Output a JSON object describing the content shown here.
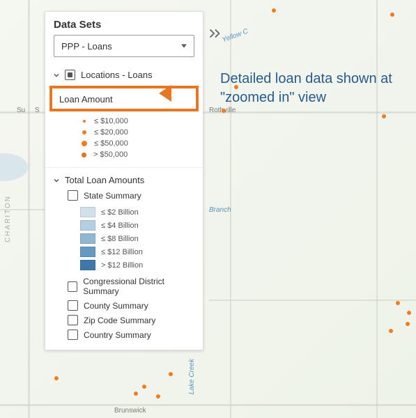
{
  "panel": {
    "title": "Data Sets",
    "dropdown_value": "PPP - Loans",
    "section1": {
      "title": "Locations - Loans",
      "checked": true,
      "highlight_label": "Loan Amount",
      "legend": [
        {
          "label": "≤ $10,000"
        },
        {
          "label": "≤ $20,000"
        },
        {
          "label": "≤ $50,000"
        },
        {
          "label": "> $50,000"
        }
      ]
    },
    "section2": {
      "title": "Total Loan Amounts",
      "state_summary": {
        "label": "State Summary",
        "swatches": [
          {
            "label": "≤ $2 Billion",
            "color": "#d0e1ec"
          },
          {
            "label": "≤ $4 Billion",
            "color": "#b3cfe1"
          },
          {
            "label": "≤ $8 Billion",
            "color": "#8fb7d2"
          },
          {
            "label": "≤ $12 Billion",
            "color": "#6699c2"
          },
          {
            "label": "> $12 Billion",
            "color": "#3d78a8"
          }
        ]
      },
      "items": [
        {
          "label": "Congressional District Summary"
        },
        {
          "label": "County Summary"
        },
        {
          "label": "Zip Code Summary"
        },
        {
          "label": "Country Summary"
        }
      ]
    }
  },
  "annotation_text": "Detailed loan data shown at \"zoomed in\" view",
  "map_labels": {
    "city1": "Su",
    "city2": "Rothville",
    "city3": "Brunswick",
    "city4": "S",
    "creek1": "Yellow C",
    "creek2": "Lake Creek",
    "creek3": "Branch",
    "region": "CHARITON"
  }
}
